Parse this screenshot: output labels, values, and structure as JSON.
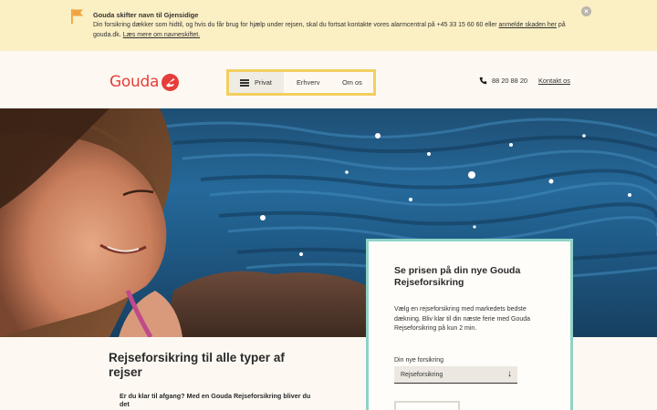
{
  "notice": {
    "title": "Gouda skifter navn til Gjensidige",
    "body_text": "Din forsikring dækker som hidtil, og hvis du får brug for hjælp under rejsen, skal du fortsat kontakte vores alarmcentral på +45 33 15 60 60 eller ",
    "link_report": "anmelde skaden her",
    "body_mid": " på gouda.dk. ",
    "link_more": "Læs mere om navneskiftet.",
    "flag_icon": "flag-icon",
    "close_icon": "close-icon"
  },
  "header": {
    "logo_text": "Gouda",
    "nav": [
      {
        "label": "Privat"
      },
      {
        "label": "Erhverv"
      },
      {
        "label": "Om os"
      }
    ],
    "phone": "88 20 88 20",
    "contact": "Kontakt os"
  },
  "main": {
    "heading": "Rejseforsikring til alle typer af rejser",
    "lead": "Er du klar til afgang? Med en Gouda Rejseforsikring bliver du det"
  },
  "card": {
    "title": "Se prisen på din nye Gouda Rejseforsikring",
    "text": "Vælg en rejseforsikring med markedets bedste dækning. Bliv klar til din næste ferie med Gouda Rejseforsikring på kun 2 min.",
    "field_label": "Din nye forsikring",
    "select_value": "Rejseforsikring",
    "select_arrow": "↓"
  },
  "colors": {
    "brand_red": "#e53e3a",
    "notice_bg": "#fbefc4",
    "nav_border": "#f2cf5f",
    "card_border": "#8fd3c7"
  }
}
